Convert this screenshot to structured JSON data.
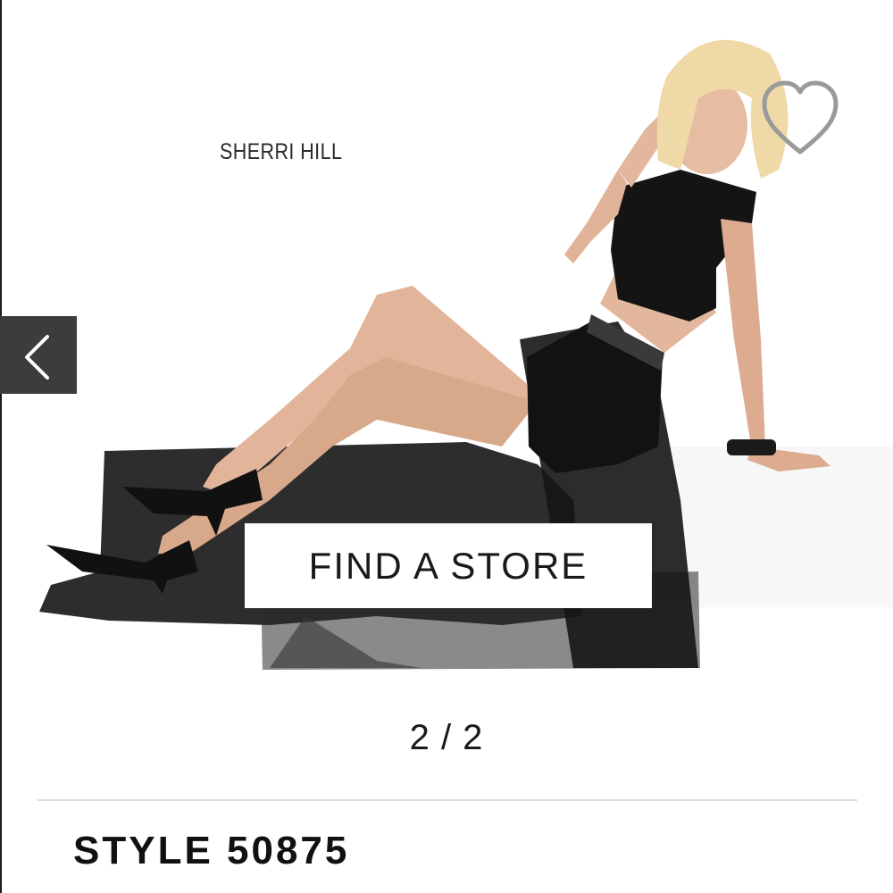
{
  "product": {
    "brand": "SHERRI HILL",
    "style_title": "STYLE 50875"
  },
  "gallery": {
    "current": 2,
    "total": 2,
    "counter_text": "2 / 2",
    "prev_icon": "chevron-left-icon",
    "favorite_icon": "heart-outline-icon"
  },
  "actions": {
    "find_store_label": "FIND A STORE"
  },
  "colors": {
    "dress": "#141414",
    "prev_button_bg": "#3c3c3c",
    "favorite_stroke": "#9a9a9a"
  }
}
